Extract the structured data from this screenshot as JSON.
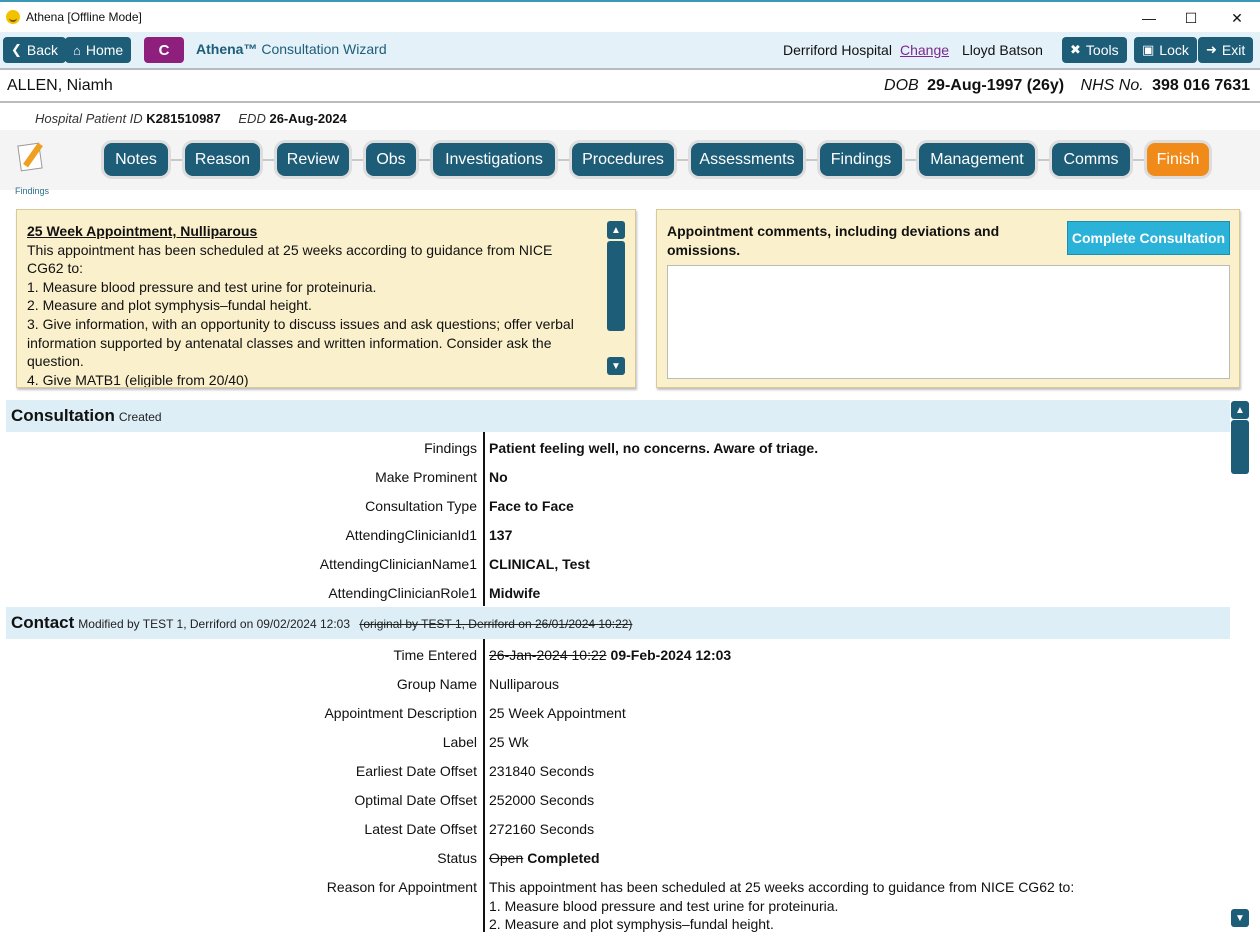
{
  "window": {
    "title": "Athena [Offline Mode]"
  },
  "toolbar": {
    "back": "Back",
    "home": "Home",
    "c_button": "C",
    "brand_name": "Athena™",
    "brand_sub": "Consultation Wizard",
    "hospital": "Derriford Hospital",
    "change": "Change",
    "user": "Lloyd Batson",
    "tools": "Tools",
    "lock": "Lock",
    "exit": "Exit"
  },
  "patient": {
    "name": "ALLEN, Niamh",
    "dob_label": "DOB",
    "dob": "29-Aug-1997 (26y)",
    "nhs_label": "NHS No.",
    "nhs": "398 016 7631",
    "hpid_label": "Hospital Patient ID",
    "hpid": "K281510987",
    "edd_label": "EDD",
    "edd": "26-Aug-2024"
  },
  "tabs": {
    "icon_label": "Findings",
    "items": [
      "Notes",
      "Reason",
      "Review",
      "Obs",
      "Investigations",
      "Procedures",
      "Assessments",
      "Findings",
      "Management",
      "Comms",
      "Finish"
    ]
  },
  "guidance": {
    "title": "25 Week Appointment, Nulliparous",
    "lines": [
      "This appointment has been scheduled at 25 weeks according to guidance from NICE CG62 to:",
      "1. Measure blood pressure and test urine for proteinuria.",
      "2. Measure and plot symphysis–fundal height.",
      "3. Give information, with an opportunity to discuss issues and ask questions; offer verbal information supported by antenatal classes and written information. Consider ask the question.",
      "4. Give MATB1 (eligible from 20/40)"
    ]
  },
  "comments": {
    "label": "Appointment comments, including deviations and omissions.",
    "button": "Complete Consultation",
    "value": ""
  },
  "consultation": {
    "title": "Consultation",
    "status": "Created",
    "rows": [
      {
        "key": "Findings",
        "value": "Patient feeling well, no concerns. Aware of triage."
      },
      {
        "key": "Make Prominent",
        "value": "No"
      },
      {
        "key": "Consultation Type",
        "value": "Face to Face"
      },
      {
        "key": "AttendingClinicianId1",
        "value": "137"
      },
      {
        "key": "AttendingClinicianName1",
        "value": "CLINICAL, Test"
      },
      {
        "key": "AttendingClinicianRole1",
        "value": "Midwife"
      }
    ]
  },
  "contact": {
    "title": "Contact",
    "modified": "Modified by TEST 1, Derriford on 09/02/2024 12:03",
    "original": "(original by TEST 1, Derriford on 26/01/2024 10:22)",
    "time_key": "Time Entered",
    "time_old": "26-Jan-2024 10:22",
    "time_new": "09-Feb-2024 12:03",
    "rows": [
      {
        "key": "Group Name",
        "value": "Nulliparous"
      },
      {
        "key": "Appointment Description",
        "value": "25 Week Appointment"
      },
      {
        "key": "Label",
        "value": "25 Wk"
      },
      {
        "key": "Earliest Date Offset",
        "value": "231840 Seconds"
      },
      {
        "key": "Optimal Date Offset",
        "value": "252000 Seconds"
      },
      {
        "key": "Latest Date Offset",
        "value": "272160 Seconds"
      }
    ],
    "status_key": "Status",
    "status_old": "Open",
    "status_new": "Completed",
    "reason_key": "Reason for Appointment",
    "reason_lines": [
      "This appointment has been scheduled at 25 weeks according to guidance from NICE CG62 to:",
      "1. Measure blood pressure and test urine for proteinuria.",
      "2. Measure and plot symphysis–fundal height."
    ]
  },
  "colors": {
    "primary": "#1d5d78",
    "finish": "#f08a18",
    "c_button": "#8e1f7c",
    "panel": "#fbf0cc",
    "section": "#ddeef6",
    "complete": "#2bb2d8"
  }
}
